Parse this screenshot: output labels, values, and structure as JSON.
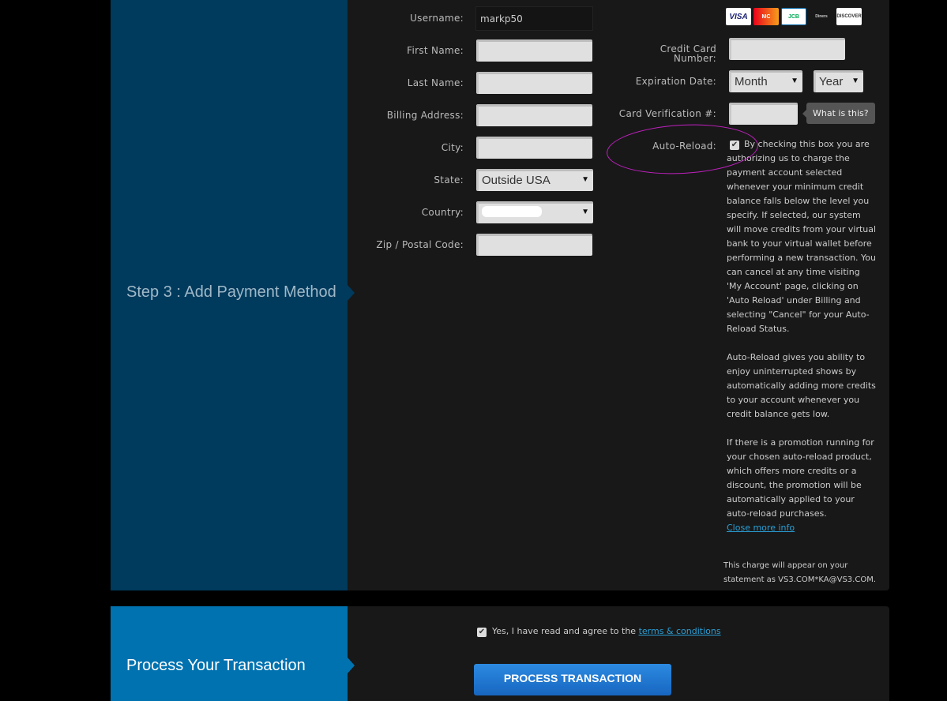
{
  "step3": {
    "title": "Step 3 : Add Payment Method"
  },
  "form": {
    "username_label": "Username:",
    "username_value": "markp50",
    "first_name_label": "First Name:",
    "last_name_label": "Last Name:",
    "billing_address_label": "Billing Address:",
    "city_label": "City:",
    "state_label": "State:",
    "state_value": "Outside USA",
    "country_label": "Country:",
    "zip_label": "Zip / Postal Code:"
  },
  "card": {
    "logos": [
      "VISA",
      "MasterCard",
      "JCB",
      "Diners Club International",
      "DISCOVER"
    ],
    "number_label": "Credit Card Number:",
    "expiration_label": "Expiration Date:",
    "month_value": "Month",
    "year_value": "Year",
    "cvv_label": "Card Verification #:",
    "what_is_this": "What is this?",
    "auto_reload_label": "Auto-Reload:",
    "auto_reload_checked": true,
    "auto_reload_p1": "By checking this box you are authorizing us to charge the payment account selected whenever your minimum credit balance falls below the level you specify. If selected, our system will move credits from your virtual bank to your virtual wallet before performing a new transaction. You can cancel at any time visiting 'My Account' page, clicking on 'Auto Reload' under Billing and selecting \"Cancel\" for your Auto-Reload Status.",
    "auto_reload_p2": "Auto-Reload gives you ability to enjoy uninterrupted shows by automatically adding more credits to your account whenever you credit balance gets low.",
    "auto_reload_p3": "If there is a promotion running for your chosen auto-reload product, which offers more credits or a discount, the promotion will be automatically applied to your auto-reload purchases.",
    "close_more_info": "Close more info",
    "statement": "This charge will appear on your statement as VS3.COM*KA@VS3.COM."
  },
  "process": {
    "title": "Process Your Transaction",
    "agree_text": "Yes, I have read and agree to the ",
    "terms_link": "terms & conditions",
    "agree_checked": true,
    "button": "PROCESS TRANSACTION"
  },
  "colors": {
    "step_panel": "#003a5c",
    "process_panel": "#0072b0",
    "annotation": "#c020c0",
    "link": "#2a9fd6"
  }
}
